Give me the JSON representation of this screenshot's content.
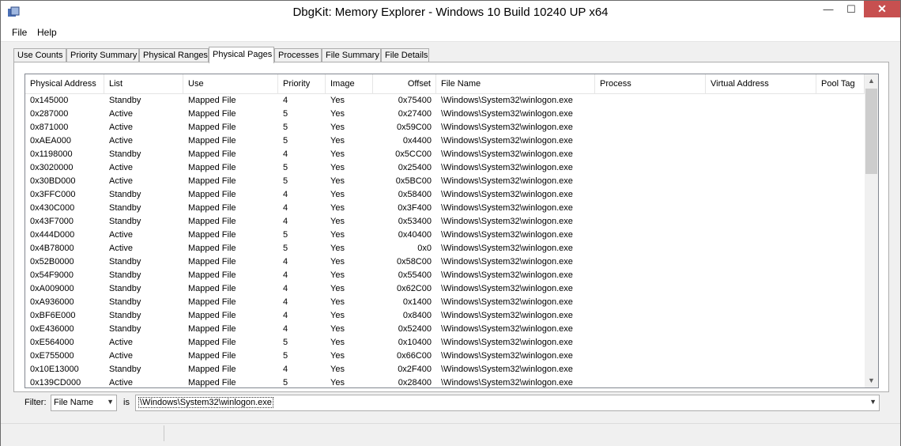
{
  "window": {
    "title": "DbgKit: Memory Explorer - Windows 10 Build 10240 UP x64",
    "close_color": "#c75050"
  },
  "menu": {
    "items": [
      "File",
      "Help"
    ]
  },
  "tabs": [
    "Use Counts",
    "Priority Summary",
    "Physical Ranges",
    "Physical Pages",
    "Processes",
    "File Summary",
    "File Details"
  ],
  "active_tab": "Physical Pages",
  "table": {
    "columns": [
      "Physical Address",
      "List",
      "Use",
      "Priority",
      "Image",
      "Offset",
      "File Name",
      "Process",
      "Virtual Address",
      "Pool Tag"
    ],
    "rows": [
      [
        "0x145000",
        "Standby",
        "Mapped File",
        "4",
        "Yes",
        "0x75400",
        "\\Windows\\System32\\winlogon.exe",
        "",
        "",
        ""
      ],
      [
        "0x287000",
        "Active",
        "Mapped File",
        "5",
        "Yes",
        "0x27400",
        "\\Windows\\System32\\winlogon.exe",
        "",
        "",
        ""
      ],
      [
        "0x871000",
        "Active",
        "Mapped File",
        "5",
        "Yes",
        "0x59C00",
        "\\Windows\\System32\\winlogon.exe",
        "",
        "",
        ""
      ],
      [
        "0xAEA000",
        "Active",
        "Mapped File",
        "5",
        "Yes",
        "0x4400",
        "\\Windows\\System32\\winlogon.exe",
        "",
        "",
        ""
      ],
      [
        "0x1198000",
        "Standby",
        "Mapped File",
        "4",
        "Yes",
        "0x5CC00",
        "\\Windows\\System32\\winlogon.exe",
        "",
        "",
        ""
      ],
      [
        "0x3020000",
        "Active",
        "Mapped File",
        "5",
        "Yes",
        "0x25400",
        "\\Windows\\System32\\winlogon.exe",
        "",
        "",
        ""
      ],
      [
        "0x30BD000",
        "Active",
        "Mapped File",
        "5",
        "Yes",
        "0x5BC00",
        "\\Windows\\System32\\winlogon.exe",
        "",
        "",
        ""
      ],
      [
        "0x3FFC000",
        "Standby",
        "Mapped File",
        "4",
        "Yes",
        "0x58400",
        "\\Windows\\System32\\winlogon.exe",
        "",
        "",
        ""
      ],
      [
        "0x430C000",
        "Standby",
        "Mapped File",
        "4",
        "Yes",
        "0x3F400",
        "\\Windows\\System32\\winlogon.exe",
        "",
        "",
        ""
      ],
      [
        "0x43F7000",
        "Standby",
        "Mapped File",
        "4",
        "Yes",
        "0x53400",
        "\\Windows\\System32\\winlogon.exe",
        "",
        "",
        ""
      ],
      [
        "0x444D000",
        "Active",
        "Mapped File",
        "5",
        "Yes",
        "0x40400",
        "\\Windows\\System32\\winlogon.exe",
        "",
        "",
        ""
      ],
      [
        "0x4B78000",
        "Active",
        "Mapped File",
        "5",
        "Yes",
        "0x0",
        "\\Windows\\System32\\winlogon.exe",
        "",
        "",
        ""
      ],
      [
        "0x52B0000",
        "Standby",
        "Mapped File",
        "4",
        "Yes",
        "0x58C00",
        "\\Windows\\System32\\winlogon.exe",
        "",
        "",
        ""
      ],
      [
        "0x54F9000",
        "Standby",
        "Mapped File",
        "4",
        "Yes",
        "0x55400",
        "\\Windows\\System32\\winlogon.exe",
        "",
        "",
        ""
      ],
      [
        "0xA009000",
        "Standby",
        "Mapped File",
        "4",
        "Yes",
        "0x62C00",
        "\\Windows\\System32\\winlogon.exe",
        "",
        "",
        ""
      ],
      [
        "0xA936000",
        "Standby",
        "Mapped File",
        "4",
        "Yes",
        "0x1400",
        "\\Windows\\System32\\winlogon.exe",
        "",
        "",
        ""
      ],
      [
        "0xBF6E000",
        "Standby",
        "Mapped File",
        "4",
        "Yes",
        "0x8400",
        "\\Windows\\System32\\winlogon.exe",
        "",
        "",
        ""
      ],
      [
        "0xE436000",
        "Standby",
        "Mapped File",
        "4",
        "Yes",
        "0x52400",
        "\\Windows\\System32\\winlogon.exe",
        "",
        "",
        ""
      ],
      [
        "0xE564000",
        "Active",
        "Mapped File",
        "5",
        "Yes",
        "0x10400",
        "\\Windows\\System32\\winlogon.exe",
        "",
        "",
        ""
      ],
      [
        "0xE755000",
        "Active",
        "Mapped File",
        "5",
        "Yes",
        "0x66C00",
        "\\Windows\\System32\\winlogon.exe",
        "",
        "",
        ""
      ],
      [
        "0x10E13000",
        "Standby",
        "Mapped File",
        "4",
        "Yes",
        "0x2F400",
        "\\Windows\\System32\\winlogon.exe",
        "",
        "",
        ""
      ],
      [
        "0x139CD000",
        "Active",
        "Mapped File",
        "5",
        "Yes",
        "0x28400",
        "\\Windows\\System32\\winlogon.exe",
        "",
        "",
        ""
      ]
    ]
  },
  "filter": {
    "label": "Filter:",
    "field": "File Name",
    "operator": "is",
    "value": "\\Windows\\System32\\winlogon.exe"
  }
}
